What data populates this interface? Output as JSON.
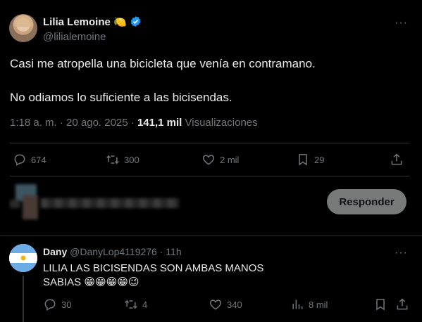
{
  "tweet": {
    "author_name": "Lilia Lemoine",
    "author_emoji": "🍋",
    "author_handle": "@lilialemoine",
    "more_label": "···",
    "text_line1": "Casi me atropella una bicicleta que venía en contramano.",
    "text_line2": "No odiamos lo suficiente a las bicisendas.",
    "time": "1:18 a. m. · 20 ago. 2025 · ",
    "views_count": "141,1 mil",
    "views_label": " Visualizaciones",
    "actions": {
      "replies": "674",
      "retweets": "300",
      "likes": "2 mil",
      "bookmarks": "29"
    },
    "icons": [
      "verified-badge-icon",
      "reply-icon",
      "retweet-icon",
      "like-icon",
      "bookmark-icon",
      "share-icon",
      "more-icon"
    ]
  },
  "composer": {
    "reply_button_label": "Responder"
  },
  "reply": {
    "author_name": "Dany",
    "author_handle": "@DanyLop4119276",
    "time": " · 11h",
    "more_label": "···",
    "text_line1": "LILIA LAS BICISENDAS SON AMBAS MANOS",
    "text_line2": "SABIAS 😁😁😁😁😉",
    "actions": {
      "replies": "30",
      "retweets": "4",
      "likes": "340",
      "views": "8 mil"
    }
  },
  "colors": {
    "background": "#000000",
    "text": "#e7e9ea",
    "muted": "#71767b",
    "verified": "#1d9bf0",
    "divider": "#2f3336",
    "reply_button_bg": "#787a7a"
  }
}
